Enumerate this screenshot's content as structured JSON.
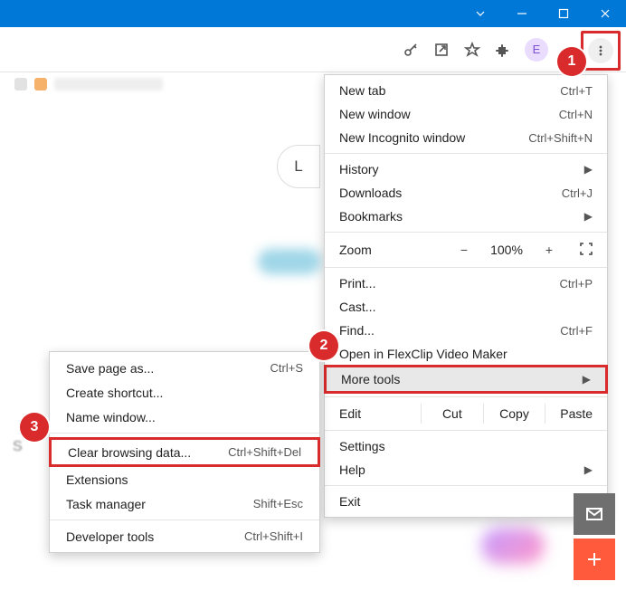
{
  "badges": {
    "one": "1",
    "two": "2",
    "three": "3"
  },
  "avatar_letter": "E",
  "pagehint_letter": "L",
  "side_text": "S",
  "menu": {
    "new_tab": {
      "label": "New tab",
      "shortcut": "Ctrl+T"
    },
    "new_window": {
      "label": "New window",
      "shortcut": "Ctrl+N"
    },
    "new_incognito": {
      "label": "New Incognito window",
      "shortcut": "Ctrl+Shift+N"
    },
    "history": {
      "label": "History"
    },
    "downloads": {
      "label": "Downloads",
      "shortcut": "Ctrl+J"
    },
    "bookmarks": {
      "label": "Bookmarks"
    },
    "zoom": {
      "label": "Zoom",
      "minus": "−",
      "pct": "100%",
      "plus": "+"
    },
    "print": {
      "label": "Print...",
      "shortcut": "Ctrl+P"
    },
    "cast": {
      "label": "Cast..."
    },
    "find": {
      "label": "Find...",
      "shortcut": "Ctrl+F"
    },
    "flexclip": {
      "label": "Open in FlexClip Video Maker"
    },
    "more_tools": {
      "label": "More tools"
    },
    "edit": {
      "label": "Edit",
      "cut": "Cut",
      "copy": "Copy",
      "paste": "Paste"
    },
    "settings": {
      "label": "Settings"
    },
    "help": {
      "label": "Help"
    },
    "exit": {
      "label": "Exit"
    }
  },
  "submenu": {
    "save_page": {
      "label": "Save page as...",
      "shortcut": "Ctrl+S"
    },
    "create_shortcut": {
      "label": "Create shortcut..."
    },
    "name_window": {
      "label": "Name window..."
    },
    "clear_data": {
      "label": "Clear browsing data...",
      "shortcut": "Ctrl+Shift+Del"
    },
    "extensions": {
      "label": "Extensions"
    },
    "task_manager": {
      "label": "Task manager",
      "shortcut": "Shift+Esc"
    },
    "dev_tools": {
      "label": "Developer tools",
      "shortcut": "Ctrl+Shift+I"
    }
  }
}
